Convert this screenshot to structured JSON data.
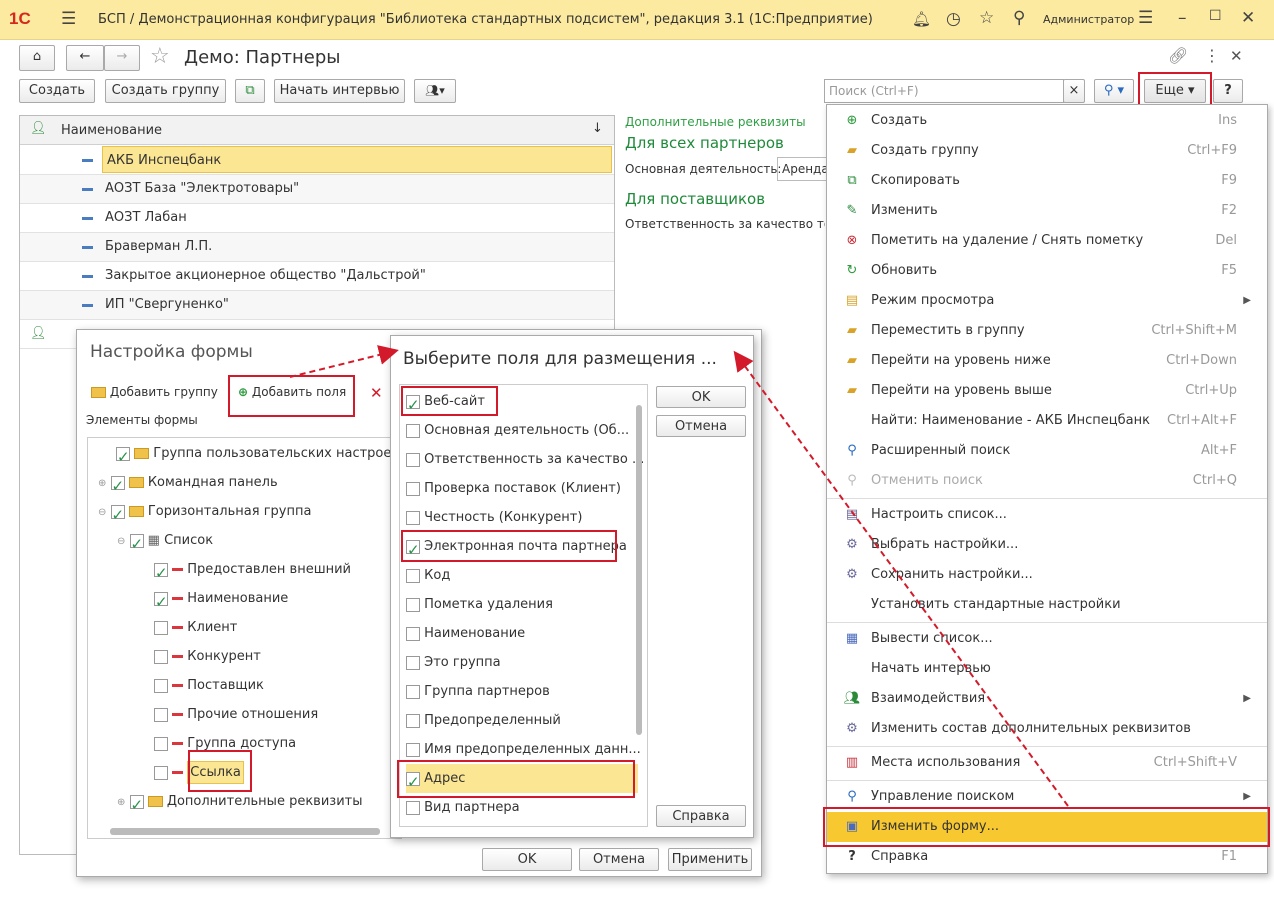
{
  "titlebar": {
    "logo": "1С",
    "title": "БСП / Демонстрационная конфигурация \"Библиотека стандартных подсистем\", редакция 3.1  (1С:Предприятие)",
    "user": "Администратор"
  },
  "form": {
    "title": "Демо: Партнеры",
    "toolbar": {
      "create": "Создать",
      "create_group": "Создать группу",
      "start_interview": "Начать интервью",
      "more": "Еще",
      "help": "?"
    },
    "search": {
      "placeholder": "Поиск (Ctrl+F)",
      "clear": "×"
    }
  },
  "list": {
    "column": "Наименование",
    "sort": "↓",
    "rows": [
      "АКБ Инспецбанк",
      "АОЗТ База \"Электротовары\"",
      "АОЗТ Лабан",
      "Браверман Л.П.",
      "Закрытое акционерное общество \"Дальстрой\"",
      "ИП \"Свергуненко\""
    ]
  },
  "right_panel": {
    "title": "Дополнительные реквизиты",
    "h1": "Для всех партнеров",
    "f1": "Основная деятельность:",
    "f1_value": "Аренда",
    "h2": "Для поставщиков",
    "f2": "Ответственность за качество това"
  },
  "menu": {
    "items": [
      {
        "label": "Создать",
        "shortcut": "Ins",
        "icon": "add-icon"
      },
      {
        "label": "Создать группу",
        "shortcut": "Ctrl+F9",
        "icon": "folder-add-icon"
      },
      {
        "label": "Скопировать",
        "shortcut": "F9",
        "icon": "copy-icon"
      },
      {
        "label": "Изменить",
        "shortcut": "F2",
        "icon": "pencil-icon"
      },
      {
        "label": "Пометить на удаление / Снять пометку",
        "shortcut": "Del",
        "icon": "delete-mark-icon"
      },
      {
        "label": "Обновить",
        "shortcut": "F5",
        "icon": "refresh-icon"
      },
      {
        "label": "Режим просмотра",
        "shortcut": "",
        "icon": "view-mode-icon"
      },
      {
        "label": "Переместить в группу",
        "shortcut": "Ctrl+Shift+M",
        "icon": "move-to-group-icon"
      },
      {
        "label": "Перейти на уровень ниже",
        "shortcut": "Ctrl+Down",
        "icon": "level-down-icon"
      },
      {
        "label": "Перейти на уровень выше",
        "shortcut": "Ctrl+Up",
        "icon": "level-up-icon"
      },
      {
        "label": "Найти: Наименование - АКБ Инспецбанк",
        "shortcut": "Ctrl+Alt+F",
        "icon": ""
      },
      {
        "label": "Расширенный поиск",
        "shortcut": "Alt+F",
        "icon": "search-icon"
      },
      {
        "label": "Отменить поиск",
        "shortcut": "Ctrl+Q",
        "icon": "search-cancel-icon"
      },
      {
        "label": "Настроить список...",
        "shortcut": "",
        "icon": "list-settings-icon"
      },
      {
        "label": "Выбрать настройки...",
        "shortcut": "",
        "icon": "select-settings-icon"
      },
      {
        "label": "Сохранить настройки...",
        "shortcut": "",
        "icon": "save-settings-icon"
      },
      {
        "label": "Установить стандартные настройки",
        "shortcut": "",
        "icon": ""
      },
      {
        "label": "Вывести список...",
        "shortcut": "",
        "icon": "print-list-icon"
      },
      {
        "label": "Начать интервью",
        "shortcut": "",
        "icon": ""
      },
      {
        "label": "Взаимодействия",
        "shortcut": "",
        "icon": "interactions-icon"
      },
      {
        "label": "Изменить состав дополнительных реквизитов",
        "shortcut": "",
        "icon": "attributes-icon"
      },
      {
        "label": "Места использования",
        "shortcut": "Ctrl+Shift+V",
        "icon": "usage-icon"
      },
      {
        "label": "Управление поиском",
        "shortcut": "",
        "icon": "search-icon"
      },
      {
        "label": "Изменить форму...",
        "shortcut": "",
        "icon": "form-icon"
      },
      {
        "label": "Справка",
        "shortcut": "F1",
        "icon": "help-icon"
      }
    ]
  },
  "form_settings": {
    "title": "Настройка формы",
    "add_group": "Добавить группу",
    "add_fields": "Добавить поля",
    "elements_label": "Элементы формы",
    "tree": [
      "Группа пользовательских настроек",
      "Командная панель",
      "Горизонтальная группа",
      "Список",
      "Предоставлен внешний",
      "Наименование",
      "Клиент",
      "Конкурент",
      "Поставщик",
      "Прочие отношения",
      "Группа доступа",
      "Ссылка",
      "Дополнительные реквизиты"
    ],
    "ok": "OK",
    "cancel": "Отмена",
    "apply": "Применить"
  },
  "field_picker": {
    "title": "Выберите поля для размещения ...",
    "fields": [
      "Веб-сайт",
      "Основная деятельность (Об...",
      "Ответственность за качество ...",
      "Проверка поставок (Клиент)",
      "Честность (Конкурент)",
      "Электронная почта партнера",
      "Код",
      "Пометка удаления",
      "Наименование",
      "Это группа",
      "Группа партнеров",
      "Предопределенный",
      "Имя предопределенных данн...",
      "Адрес",
      "Вид партнера"
    ],
    "ok": "OK",
    "cancel": "Отмена",
    "help": "Справка"
  }
}
